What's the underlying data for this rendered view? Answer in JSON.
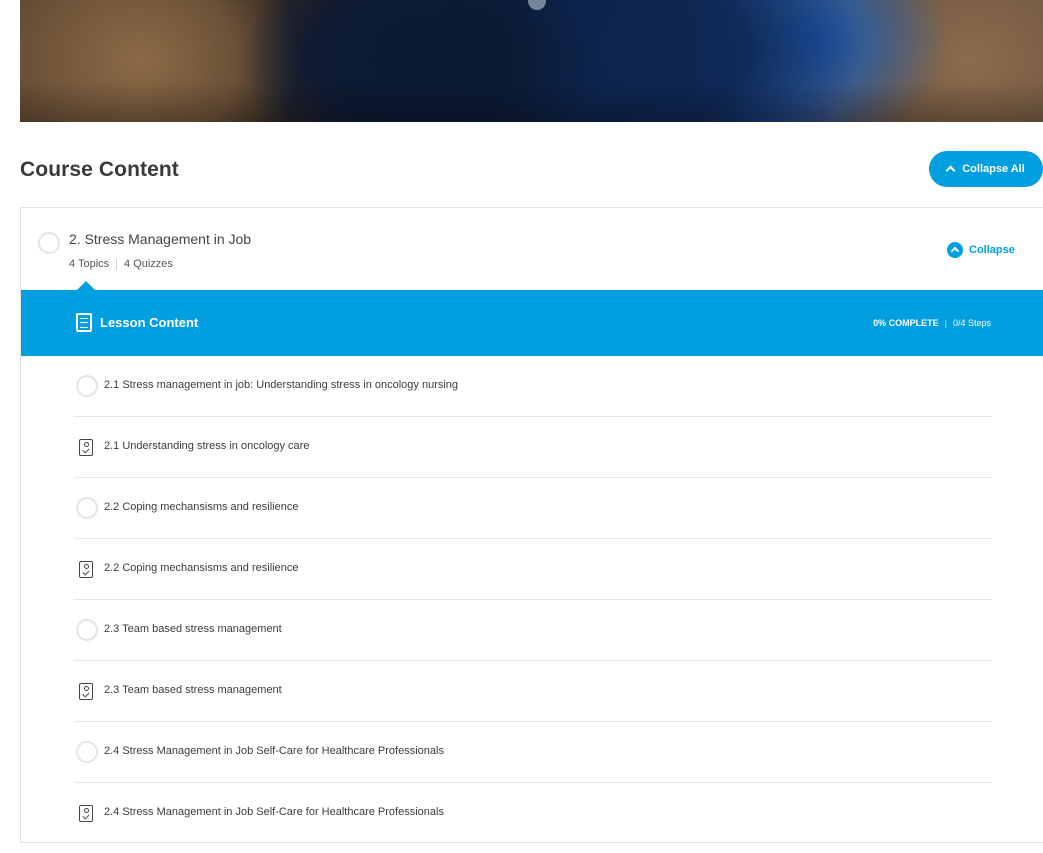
{
  "hero": {
    "icon": "course-banner-image"
  },
  "course_content": {
    "title": "Course Content",
    "collapse_all_label": "Collapse All"
  },
  "lesson": {
    "title": "2. Stress Management in Job",
    "topics": "4 Topics",
    "quizzes": "4 Quizzes",
    "collapse_label": "Collapse",
    "content_bar": {
      "title": "Lesson Content",
      "percent_complete": "0% COMPLETE",
      "steps": "0/4 Steps",
      "accent_color": "#019ee0"
    },
    "items": [
      {
        "type": "topic",
        "icon": "status-circle-icon",
        "label": "2.1 Stress management in job: Understanding stress in oncology nursing"
      },
      {
        "type": "quiz",
        "icon": "quiz-icon",
        "label": "2.1 Understanding stress in oncology care"
      },
      {
        "type": "topic",
        "icon": "status-circle-icon",
        "label": "2.2 Coping mechansisms and resilience"
      },
      {
        "type": "quiz",
        "icon": "quiz-icon",
        "label": "2.2 Coping mechansisms and resilience"
      },
      {
        "type": "topic",
        "icon": "status-circle-icon",
        "label": "2.3 Team based stress management"
      },
      {
        "type": "quiz",
        "icon": "quiz-icon",
        "label": "2.3 Team based stress management"
      },
      {
        "type": "topic",
        "icon": "status-circle-icon",
        "label": "2.4 Stress Management in Job Self-Care for Healthcare Professionals"
      },
      {
        "type": "quiz",
        "icon": "quiz-icon",
        "label": "2.4 Stress Management in Job Self-Care for Healthcare Professionals"
      }
    ]
  }
}
